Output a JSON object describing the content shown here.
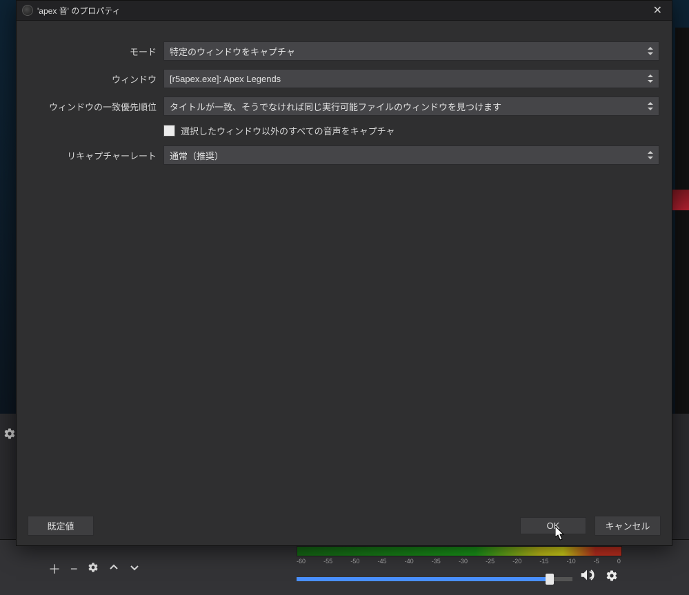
{
  "titlebar": {
    "title": "'apex 音' のプロパティ"
  },
  "form": {
    "mode": {
      "label": "モード",
      "value": "特定のウィンドウをキャプチャ"
    },
    "window": {
      "label": "ウィンドウ",
      "value": "[r5apex.exe]: Apex Legends"
    },
    "priority": {
      "label": "ウィンドウの一致優先順位",
      "value": "タイトルが一致、そうでなければ同じ実行可能ファイルのウィンドウを見つけます"
    },
    "checkbox": {
      "label": "選択したウィンドウ以外のすべての音声をキャプチャ",
      "checked": false
    },
    "rate": {
      "label": "リキャプチャーレート",
      "value": "通常（推奨）"
    }
  },
  "buttons": {
    "defaults": "既定値",
    "ok": "OK",
    "cancel": "キャンセル"
  },
  "mixer": {
    "ticks": [
      "-60",
      "-55",
      "-50",
      "-45",
      "-40",
      "-35",
      "-30",
      "-25",
      "-20",
      "-15",
      "-10",
      "-5",
      "0"
    ]
  }
}
